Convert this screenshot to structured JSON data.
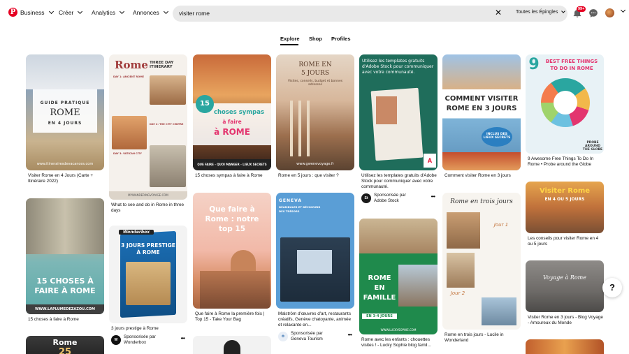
{
  "header": {
    "logo": "P",
    "nav": [
      "Business",
      "Créer",
      "Analytics",
      "Annonces"
    ],
    "search_value": "visiter rome",
    "search_scope": "Toutes les Épingles",
    "notifications_badge": "99+"
  },
  "tabs": [
    "Explore",
    "Shop",
    "Profiles"
  ],
  "active_tab": "Explore",
  "pins": {
    "c1": [
      {
        "title": "Visiter Rome en 4 Jours (Carte + Itinéraire 2022)",
        "overlay": [
          "GUIDE PRATIQUE",
          "ROME",
          "EN 4 JOURS",
          "www.itinerairesdevacances.com"
        ]
      },
      {
        "title": "15 choses à faire à Rome",
        "overlay": [
          "15 CHOSES À",
          "FAIRE À ROME",
          "WWW.LAPLUMEDEZAZOU.COM"
        ]
      },
      {
        "overlay": [
          "Rome",
          "25"
        ]
      }
    ],
    "c2": [
      {
        "title": "What to see and do in Rome in three days",
        "overlay": [
          "Rome",
          "THREE DAY ITINERARY",
          "DAY 1: ANCIENT ROME",
          "DAY 2: THE CITY CENTRE",
          "DAY 3: VATICAN CITY",
          "MYWANDERINGVOYAGE.COM"
        ]
      },
      {
        "title": "3 jours prestige à Rome",
        "overlay": [
          "Wonderbox",
          "3 JOURS PRESTIGE",
          "À ROME"
        ],
        "sponsor": {
          "label": "Sponsorisée par",
          "name": "Wonderbox"
        }
      }
    ],
    "c3": [
      {
        "title": "15 choses sympas à faire à Rome",
        "overlay": [
          "15",
          "choses sympas",
          "à faire",
          "à ROME",
          "QUE FAIRE - QUOI MANGER - LIEUX SECRETS"
        ]
      },
      {
        "title": "Que faire à Rome la première fois | Top 15 - Take Your Bag",
        "overlay": [
          "Que faire à",
          "Rome : notre",
          "top 15"
        ]
      }
    ],
    "c4": [
      {
        "title": "Rome en 5 jours : que visiter ?",
        "overlay": [
          "ROME EN",
          "5 JOURS",
          "Visites, conseils, budget et bonnes adresses",
          "www.gwenevoyage.fr"
        ]
      },
      {
        "title": "Malström d'œuvres d'art, restaurants créatifs, Genève chatoyante, animée et relaxante en...",
        "overlay": [
          "GENEVA",
          "DÉAMBULER ET DÉCOUVRIR",
          "DES TRÉSORS"
        ],
        "sponsor": {
          "label": "Sponsorisée par",
          "name": "Geneva Tourism"
        }
      }
    ],
    "c5": [
      {
        "title": "Utilisez les templates gratuits d'Adobe Stock pour communiquer avec votre communauté.",
        "overlay": [
          "Utilisez les templates gratuits d'Adobe Stock pour communiquer avec votre communauté."
        ],
        "sponsor": {
          "label": "Sponsorisée par",
          "name": "Adobe Stock"
        }
      },
      {
        "title": "Rome avec les enfants : chouettes visites ! - Lucky Sophie blog famil...",
        "overlay": [
          "ROME",
          "EN",
          "FAMILLE",
          "EN 3-4 JOURS",
          "WWW.LUCKYSOPHIE.COM"
        ]
      }
    ],
    "c6": [
      {
        "title": "Comment visiter Rome en 3 jours",
        "overlay": [
          "COMMENT VISITER",
          "ROME EN 3 JOURS",
          "INCLUS DES LIEUX SECRETS"
        ]
      },
      {
        "title": "Rome en trois jours - Lucile in Wonderland",
        "overlay": [
          "Rome en trois jours",
          "Jour 1",
          "Jour 2"
        ]
      }
    ],
    "c7": [
      {
        "title": "9 Awesome Free Things To Do In Rome • Probe around the Globe",
        "overlay": [
          "9",
          "BEST FREE THINGS",
          "TO DO IN ROME",
          "PROBE AROUND THE GLOBE"
        ]
      },
      {
        "title": "Les conseils pour visiter Rome en 4 ou 5 jours",
        "overlay": [
          "Visiter Rome",
          "EN 4 OU 5 JOURS"
        ]
      },
      {
        "title": "Visiter Rome en 3 jours - Blog Voyage - Amoureux du Monde",
        "overlay": [
          "Voyage à Rome"
        ]
      }
    ]
  },
  "help_label": "?",
  "colors": {
    "brand": "#e60023",
    "search_bg": "#e9e9e9"
  }
}
